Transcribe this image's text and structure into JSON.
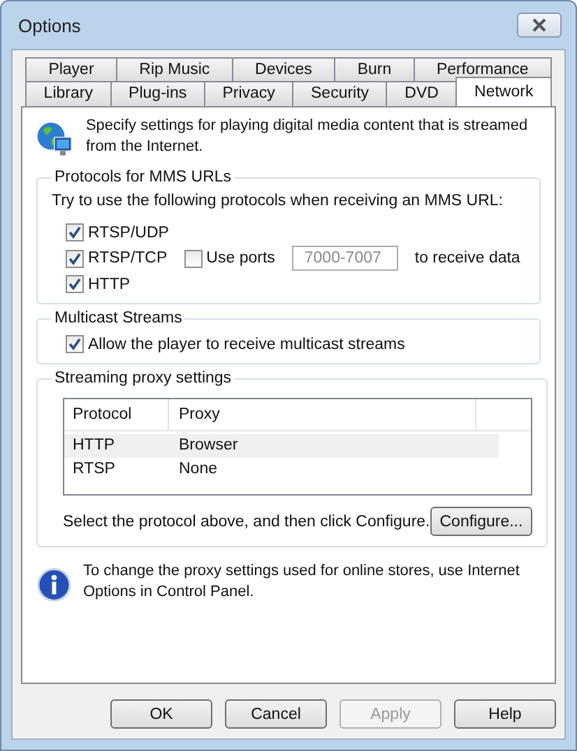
{
  "window": {
    "title": "Options"
  },
  "tab_rows": [
    [
      {
        "label": "Player",
        "selected": false
      },
      {
        "label": "Rip Music",
        "selected": false
      },
      {
        "label": "Devices",
        "selected": false
      },
      {
        "label": "Burn",
        "selected": false
      },
      {
        "label": "Performance",
        "selected": false
      }
    ],
    [
      {
        "label": "Library",
        "selected": false
      },
      {
        "label": "Plug-ins",
        "selected": false
      },
      {
        "label": "Privacy",
        "selected": false
      },
      {
        "label": "Security",
        "selected": false
      },
      {
        "label": "DVD",
        "selected": false
      },
      {
        "label": "Network",
        "selected": true
      }
    ]
  ],
  "intro": "Specify settings for playing digital media content that is streamed from the Internet.",
  "protocols": {
    "title": "Protocols for MMS URLs",
    "hint": "Try to use the following protocols when receiving an MMS URL:",
    "options": [
      {
        "label": "RTSP/UDP",
        "checked": true
      },
      {
        "label": "RTSP/TCP",
        "checked": true
      },
      {
        "label": "HTTP",
        "checked": true
      }
    ],
    "use_ports": {
      "label": "Use ports",
      "checked": false
    },
    "ports_field": {
      "value": "7000-7007",
      "disabled": true
    },
    "ports_suffix": "to receive data"
  },
  "multicast": {
    "title": "Multicast Streams",
    "option": {
      "label": "Allow the player to receive multicast streams",
      "checked": true
    }
  },
  "proxy": {
    "title": "Streaming proxy settings",
    "columns": [
      "Protocol",
      "Proxy"
    ],
    "rows": [
      {
        "cells": [
          "HTTP",
          "Browser"
        ],
        "selected": true
      },
      {
        "cells": [
          "RTSP",
          "None"
        ],
        "selected": false
      }
    ],
    "note": "Select the protocol above, and then click Configure.",
    "configure": "Configure..."
  },
  "info": "To change the proxy settings used for online stores, use Internet Options in Control Panel.",
  "buttons": [
    {
      "label": "OK",
      "disabled": false
    },
    {
      "label": "Cancel",
      "disabled": false
    },
    {
      "label": "Apply",
      "disabled": true
    },
    {
      "label": "Help",
      "disabled": false
    }
  ]
}
